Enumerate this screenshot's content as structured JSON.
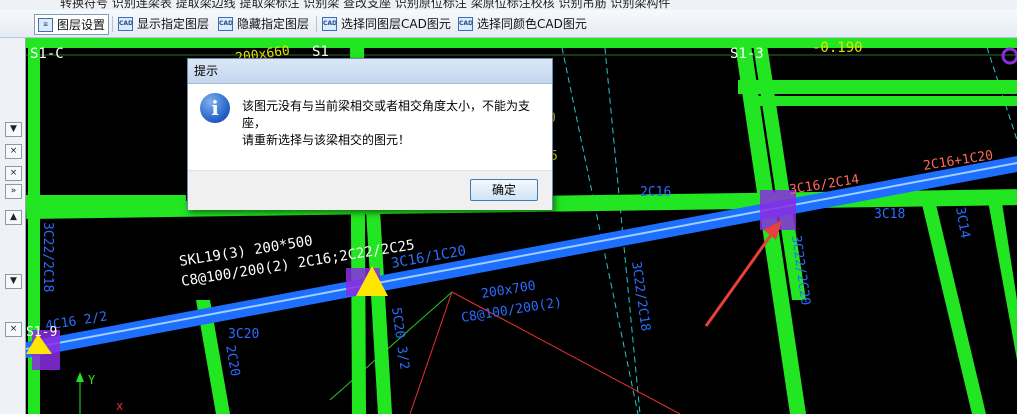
{
  "toolbar_top": {
    "visible_fragments": "转换符号   识别连梁表   提取梁边线   提取梁标注   识别梁   查改支座   识别原位标注   梁原位标注校核   识别吊筋   识别梁构件"
  },
  "toolbar": {
    "layer_settings": "图层设置",
    "show_layer": "显示指定图层",
    "hide_layer": "隐藏指定图层",
    "select_same_layer": "选择同图层CAD图元",
    "select_same_color": "选择同颜色CAD图元"
  },
  "left_panel": {
    "close_glyph": "×",
    "expand_glyph": "»",
    "arrow_up": "▲",
    "arrow_down": "▼"
  },
  "cad_labels": {
    "s1c": "S1-C",
    "s1top": "S1",
    "s13": "S1-3",
    "elev": "-0.190",
    "dim660": "200x660",
    "skl": "SKL19(3) 200*500",
    "c8a": "C8@100/200(2) 2C16;2C22/2C25",
    "c3c16_1c20": "3C16/1C20",
    "c2c16": "2C16",
    "c3c16_2c14": "3C16/2C14",
    "c2c16p1c20": "2C16+1C20",
    "c3c18": "3C18",
    "c3c14": "3C14",
    "c3c22_2c18_left": "3C22/2C18",
    "c4c16": "4C16 2/2",
    "s19": "S1-9",
    "c3c20": "3C20",
    "c2c20_left": "2C20",
    "c5c20": "5C20 3/2",
    "b200x700": "200x700",
    "c8b": "C8@100/200(2)",
    "c3c22_2c18_mid": "3C22/2C18",
    "c3c22_2c20": "3C22/2C20",
    "frag0": "0",
    "frag5": "5",
    "axis_y": "Y"
  },
  "dialog": {
    "title": "提示",
    "icon": "i",
    "message_line1": "该图元没有与当前梁相交或者相交角度太小，不能为支",
    "message_line2": "座，",
    "message_line3": "请重新选择与该梁相交的图元！",
    "ok_label": "确定"
  },
  "colors": {
    "beam_blue": "#1e6fff",
    "column_green": "#22e622",
    "text_blue": "#2b6cff",
    "text_white": "#ffffff",
    "text_yellow": "#e8e000",
    "text_red": "#ff6b5b",
    "arrow_red": "#e8403a",
    "support_yellow": "#ffe600",
    "support_purple": "#8a2be2"
  }
}
